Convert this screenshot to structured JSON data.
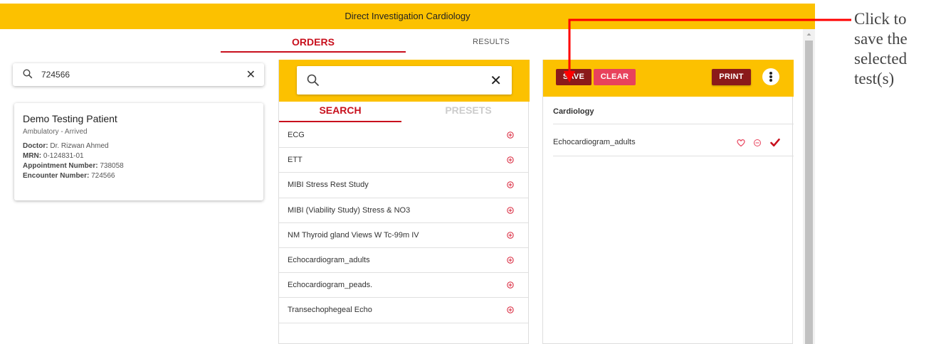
{
  "titlebar": {
    "title": "Direct Investigation Cardiology"
  },
  "tabs": {
    "orders": "ORDERS",
    "results": "RESULTS"
  },
  "patient_search": {
    "value": "724566"
  },
  "patient": {
    "name": "Demo Testing Patient",
    "status": "Ambulatory - Arrived",
    "doctor_label": "Doctor:",
    "doctor": "Dr. Rizwan Ahmed",
    "mrn_label": "MRN:",
    "mrn": "0-124831-01",
    "appointment_label": "Appointment Number:",
    "appointment": "738058",
    "encounter_label": "Encounter Number:",
    "encounter": "724566"
  },
  "middle": {
    "search_value": "",
    "subtabs": {
      "search": "SEARCH",
      "presets": "PRESETS"
    },
    "tests": [
      "ECG",
      "ETT",
      "MIBI Stress Rest Study",
      "MIBI (Viability Study) Stress & NO3",
      "NM Thyroid gland Views W Tc-99m IV",
      "Echocardiogram_adults",
      "Echocardiogram_peads.",
      "Transechophegeal Echo"
    ]
  },
  "right": {
    "buttons": {
      "save": "SAVE",
      "clear": "CLEAR",
      "print": "PRINT"
    },
    "category": "Cardiology",
    "selected": [
      "Echocardiogram_adults"
    ]
  },
  "annotation": {
    "lines": [
      "Click to",
      "save the",
      "selected",
      "test(s)"
    ]
  },
  "colors": {
    "header_yellow": "#fcc100",
    "accent_red": "#c8101d",
    "dark_red": "#8b1a1a",
    "pink_red": "#e8425c",
    "arrow_red": "#ff0000"
  },
  "icons": {
    "search": "search-icon",
    "clear": "close-icon",
    "add": "add-circle-icon",
    "favorite": "heart-icon",
    "remove": "remove-circle-icon",
    "selected": "check-icon",
    "more": "more-vertical-icon"
  }
}
